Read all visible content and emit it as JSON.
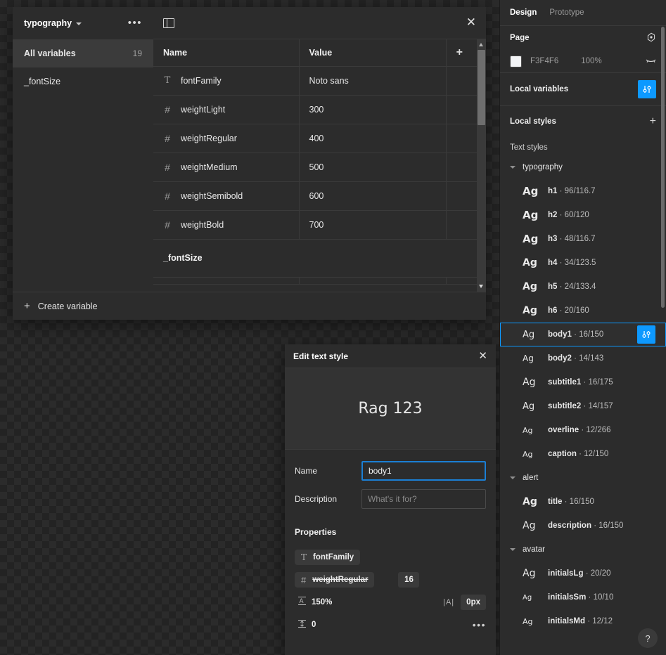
{
  "variables_modal": {
    "collection_name": "typography",
    "more_icon": "ellipsis-icon",
    "panel_toggle_icon": "panel-layout-icon",
    "close_icon": "close-icon",
    "sidebar": {
      "items": [
        {
          "label": "All variables",
          "count": "19",
          "active": true
        },
        {
          "label": "_fontSize",
          "count": "",
          "active": false
        }
      ]
    },
    "table": {
      "headers": {
        "name": "Name",
        "value": "Value",
        "add": "+"
      },
      "rows": [
        {
          "type_icon": "T",
          "name": "fontFamily",
          "value": "Noto sans"
        },
        {
          "type_icon": "#",
          "name": "weightLight",
          "value": "300"
        },
        {
          "type_icon": "#",
          "name": "weightRegular",
          "value": "400"
        },
        {
          "type_icon": "#",
          "name": "weightMedium",
          "value": "500"
        },
        {
          "type_icon": "#",
          "name": "weightSemibold",
          "value": "600"
        },
        {
          "type_icon": "#",
          "name": "weightBold",
          "value": "700"
        }
      ],
      "group_label": "_fontSize"
    },
    "create_variable_label": "Create variable"
  },
  "edit_modal": {
    "title": "Edit text style",
    "close_icon": "close-icon",
    "preview_text": "Rag 123",
    "name_label": "Name",
    "name_value": "body1",
    "description_label": "Description",
    "description_placeholder": "What's it for?",
    "properties_label": "Properties",
    "font_family_chip": {
      "icon": "T",
      "label": "fontFamily"
    },
    "font_weight_chip": {
      "icon": "#",
      "label": "weightRegular",
      "strikethrough": true
    },
    "font_size": "16",
    "line_height_icon": "line-height-icon",
    "line_height": "150%",
    "letter_spacing_icon": "letter-spacing-icon",
    "letter_spacing": "0px",
    "paragraph_spacing_icon": "paragraph-spacing-icon",
    "paragraph_spacing": "0",
    "more_icon": "ellipsis-icon"
  },
  "design_panel": {
    "tabs": [
      {
        "label": "Design",
        "active": true
      },
      {
        "label": "Prototype",
        "active": false
      }
    ],
    "page": {
      "title": "Page",
      "settings_icon": "page-settings-icon",
      "color_hex": "F3F4F6",
      "color_swatch": "#F3F4F6",
      "opacity": "100%",
      "visibility_icon": "eye-closed-icon"
    },
    "local_variables": {
      "title": "Local variables",
      "button_icon": "variables-sliders-icon",
      "accent": "#0d99ff"
    },
    "local_styles": {
      "title": "Local styles",
      "add_icon": "plus-icon"
    },
    "text_styles_label": "Text styles",
    "groups": [
      {
        "name": "typography",
        "expanded": true,
        "styles": [
          {
            "preview": "Ag",
            "name": "h1",
            "meta": "· 96/116.7",
            "size": 15,
            "weight": "bold",
            "selected": false
          },
          {
            "preview": "Ag",
            "name": "h2",
            "meta": "· 60/120",
            "size": 15,
            "weight": "bold",
            "selected": false
          },
          {
            "preview": "Ag",
            "name": "h3",
            "meta": "· 48/116.7",
            "size": 15,
            "weight": "bold",
            "selected": false
          },
          {
            "preview": "Ag",
            "name": "h4",
            "meta": "· 34/123.5",
            "size": 14,
            "weight": "bold",
            "selected": false
          },
          {
            "preview": "Ag",
            "name": "h5",
            "meta": "· 24/133.4",
            "size": 14,
            "weight": "bold",
            "selected": false
          },
          {
            "preview": "Ag",
            "name": "h6",
            "meta": "· 20/160",
            "size": 14,
            "weight": "bold",
            "selected": false
          },
          {
            "preview": "Ag",
            "name": "body1",
            "meta": "· 16/150",
            "size": 13,
            "weight": "normal",
            "selected": true
          },
          {
            "preview": "Ag",
            "name": "body2",
            "meta": "· 14/143",
            "size": 12,
            "weight": "normal",
            "selected": false
          },
          {
            "preview": "Ag",
            "name": "subtitle1",
            "meta": "· 16/175",
            "size": 14,
            "weight": "normal",
            "selected": false
          },
          {
            "preview": "Ag",
            "name": "subtitle2",
            "meta": "· 14/157",
            "size": 13,
            "weight": "normal",
            "selected": false
          },
          {
            "preview": "Ag",
            "name": "overline",
            "meta": "· 12/266",
            "size": 11,
            "weight": "normal",
            "selected": false
          },
          {
            "preview": "Ag",
            "name": "caption",
            "meta": "· 12/150",
            "size": 11,
            "weight": "normal",
            "selected": false
          }
        ]
      },
      {
        "name": "alert",
        "expanded": true,
        "styles": [
          {
            "preview": "Ag",
            "name": "title",
            "meta": "· 16/150",
            "size": 14,
            "weight": "bold",
            "selected": false
          },
          {
            "preview": "Ag",
            "name": "description",
            "meta": "· 16/150",
            "size": 14,
            "weight": "normal",
            "selected": false
          }
        ]
      },
      {
        "name": "avatar",
        "expanded": true,
        "styles": [
          {
            "preview": "Ag",
            "name": "initialsLg",
            "meta": "· 20/20",
            "size": 14,
            "weight": "normal",
            "selected": false
          },
          {
            "preview": "Ag",
            "name": "initialsSm",
            "meta": "· 10/10",
            "size": 10,
            "weight": "normal",
            "selected": false
          },
          {
            "preview": "Ag",
            "name": "initialsMd",
            "meta": "· 12/12",
            "size": 11,
            "weight": "normal",
            "selected": false
          }
        ]
      }
    ],
    "help_label": "?"
  }
}
